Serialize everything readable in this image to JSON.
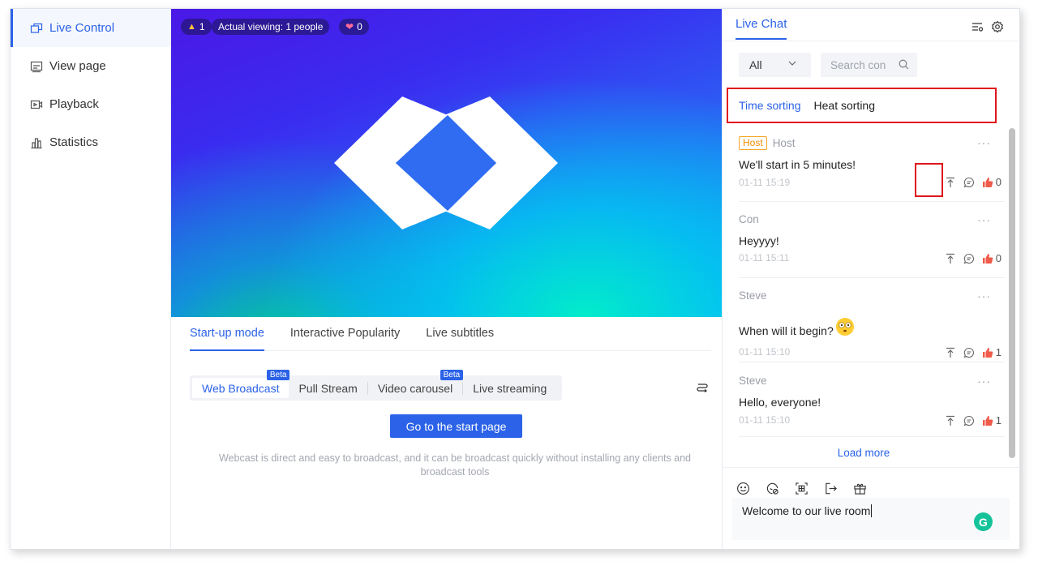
{
  "sidebar": {
    "items": [
      {
        "label": "Live Control",
        "icon": "live-control-icon",
        "active": true
      },
      {
        "label": "View page",
        "icon": "view-page-icon"
      },
      {
        "label": "Playback",
        "icon": "playback-icon"
      },
      {
        "label": "Statistics",
        "icon": "statistics-icon"
      }
    ]
  },
  "video": {
    "likes_count": "1",
    "viewing_text": "Actual viewing: 1 people",
    "hearts_count": "0"
  },
  "main_tabs": [
    "Start-up mode",
    "Interactive Popularity",
    "Live subtitles"
  ],
  "mode_tabs": [
    {
      "label": "Web Broadcast",
      "badge": "Beta",
      "active": true
    },
    {
      "label": "Pull Stream"
    },
    {
      "label": "Video carousel",
      "badge": "Beta"
    },
    {
      "label": "Live streaming"
    }
  ],
  "start_button": "Go to the start page",
  "description": "Webcast is direct and easy to broadcast, and it can be broadcast quickly without installing any clients and broadcast tools",
  "chat": {
    "tab": "Live Chat",
    "filter": "All",
    "search_placeholder": "Search con",
    "sort": [
      "Time sorting",
      "Heat sorting"
    ],
    "messages": [
      {
        "badge": "Host",
        "name": "Host",
        "text": "We'll start in 5 minutes!",
        "time": "01-11 15:19",
        "likes": "0"
      },
      {
        "name": "Con",
        "text": "Heyyyy!",
        "time": "01-11 15:11",
        "likes": "0"
      },
      {
        "name": "Steve",
        "text": "When will it begin?",
        "time": "01-11 15:10",
        "likes": "1"
      },
      {
        "name": "Steve",
        "text": "Hello, everyone!",
        "time": "01-11 15:10",
        "likes": "1"
      }
    ],
    "more": "···",
    "load_more": "Load more",
    "input_value": "Welcome to our live room",
    "grammarly": "G"
  },
  "colors": {
    "accent": "#2b62e8",
    "highlight": "#e0151c",
    "host": "#f08c00"
  }
}
